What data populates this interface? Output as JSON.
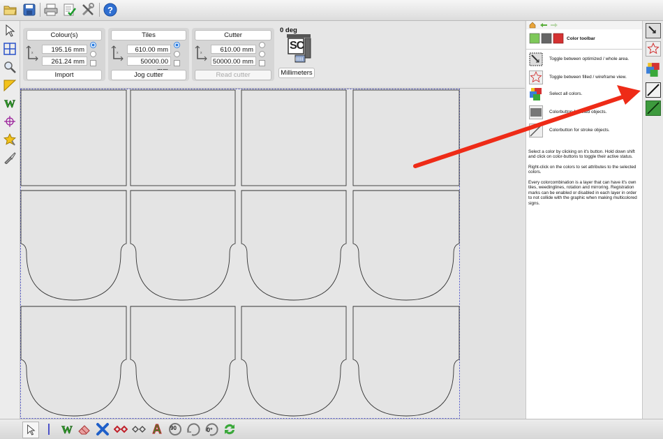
{
  "toolbar": {
    "items": [
      "open-folder-icon",
      "save-disk-icon",
      "print-icon",
      "checklist-icon",
      "settings-tools-icon",
      "help-icon"
    ]
  },
  "left_tools": [
    "pointer-icon",
    "tiles-grid-icon",
    "zoom-icon",
    "ruler-triangle-icon",
    "weedline-icon",
    "registration-mark-icon",
    "star-pin-icon",
    "knife-icon"
  ],
  "colour_group": {
    "title": "Colour(s)",
    "x_value": "195.16 mm",
    "y_value": "261.24 mm",
    "button": "Import"
  },
  "tiles_group": {
    "title": "Tiles",
    "x_value": "610.00 mm",
    "y_value": "50000.00 mm",
    "button": "Jog cutter"
  },
  "cutter_group": {
    "title": "Cutter",
    "x_value": "610.00 mm",
    "y_value": "50000.00 mm",
    "button": "Read cutter"
  },
  "cutter_widget": {
    "rotation": "0 deg",
    "logo": "SC",
    "units_button": "Millimeters"
  },
  "help_panel": {
    "nav_icons": [
      "home-icon",
      "back-arrow-icon",
      "forward-arrow-icon"
    ],
    "title": "Color toolbar",
    "rows": [
      {
        "icon": "optimized-area-icon",
        "text": "Toggle between optimized / whole area."
      },
      {
        "icon": "filled-wireframe-star-icon",
        "text": "Toggle between filled / wireframe view."
      },
      {
        "icon": "all-colors-cubes-icon",
        "text": "Select all colors."
      },
      {
        "icon": "fill-color-icon",
        "text": "Colorbutton for filled objects."
      },
      {
        "icon": "stroke-color-icon",
        "text": "Colorbutton for stroke objects."
      }
    ],
    "paragraphs": [
      "Select a color by clicking on it's button. Hold down shift and click on color-buttons to toggle their active status.",
      "Right-click on the colors to set attributes to the selected colors.",
      "Every colorcombination is a layer that can have it's own tiles, weedinglines, rotation and mirroring. Registration marks can be enabled or disabled in each layer in order to not collide with the graphic when making multicolored signs."
    ]
  },
  "color_toolbar": [
    "optimized-area-icon",
    "filled-wireframe-star-icon",
    "all-colors-cubes-icon",
    "stroke-black-color-icon",
    "stroke-green-color-icon"
  ],
  "bottom_toolbar": {
    "items": [
      "pointer-icon",
      "weed-icon",
      "eraser-icon",
      "delete-x-icon",
      "weld-icon",
      "unweld-icon",
      "text-outline-icon",
      "rotate-90-icon",
      "rotate-icon",
      "rotate-0-icon",
      "refresh-icon"
    ],
    "rotate90_label": "90",
    "rotate0_label": "0°"
  },
  "colors": {
    "accent": "#2a7ce0",
    "annotation_arrow": "#ee2b17",
    "shape_stroke": "#333333",
    "tile_border": "#4c52c9"
  }
}
